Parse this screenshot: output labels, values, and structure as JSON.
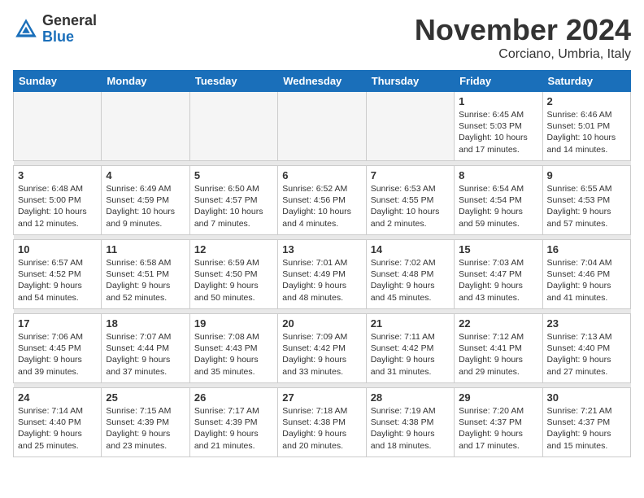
{
  "header": {
    "logo_general": "General",
    "logo_blue": "Blue",
    "month_title": "November 2024",
    "location": "Corciano, Umbria, Italy"
  },
  "weekdays": [
    "Sunday",
    "Monday",
    "Tuesday",
    "Wednesday",
    "Thursday",
    "Friday",
    "Saturday"
  ],
  "weeks": [
    {
      "days": [
        {
          "num": "",
          "info": ""
        },
        {
          "num": "",
          "info": ""
        },
        {
          "num": "",
          "info": ""
        },
        {
          "num": "",
          "info": ""
        },
        {
          "num": "",
          "info": ""
        },
        {
          "num": "1",
          "info": "Sunrise: 6:45 AM\nSunset: 5:03 PM\nDaylight: 10 hours and 17 minutes."
        },
        {
          "num": "2",
          "info": "Sunrise: 6:46 AM\nSunset: 5:01 PM\nDaylight: 10 hours and 14 minutes."
        }
      ]
    },
    {
      "days": [
        {
          "num": "3",
          "info": "Sunrise: 6:48 AM\nSunset: 5:00 PM\nDaylight: 10 hours and 12 minutes."
        },
        {
          "num": "4",
          "info": "Sunrise: 6:49 AM\nSunset: 4:59 PM\nDaylight: 10 hours and 9 minutes."
        },
        {
          "num": "5",
          "info": "Sunrise: 6:50 AM\nSunset: 4:57 PM\nDaylight: 10 hours and 7 minutes."
        },
        {
          "num": "6",
          "info": "Sunrise: 6:52 AM\nSunset: 4:56 PM\nDaylight: 10 hours and 4 minutes."
        },
        {
          "num": "7",
          "info": "Sunrise: 6:53 AM\nSunset: 4:55 PM\nDaylight: 10 hours and 2 minutes."
        },
        {
          "num": "8",
          "info": "Sunrise: 6:54 AM\nSunset: 4:54 PM\nDaylight: 9 hours and 59 minutes."
        },
        {
          "num": "9",
          "info": "Sunrise: 6:55 AM\nSunset: 4:53 PM\nDaylight: 9 hours and 57 minutes."
        }
      ]
    },
    {
      "days": [
        {
          "num": "10",
          "info": "Sunrise: 6:57 AM\nSunset: 4:52 PM\nDaylight: 9 hours and 54 minutes."
        },
        {
          "num": "11",
          "info": "Sunrise: 6:58 AM\nSunset: 4:51 PM\nDaylight: 9 hours and 52 minutes."
        },
        {
          "num": "12",
          "info": "Sunrise: 6:59 AM\nSunset: 4:50 PM\nDaylight: 9 hours and 50 minutes."
        },
        {
          "num": "13",
          "info": "Sunrise: 7:01 AM\nSunset: 4:49 PM\nDaylight: 9 hours and 48 minutes."
        },
        {
          "num": "14",
          "info": "Sunrise: 7:02 AM\nSunset: 4:48 PM\nDaylight: 9 hours and 45 minutes."
        },
        {
          "num": "15",
          "info": "Sunrise: 7:03 AM\nSunset: 4:47 PM\nDaylight: 9 hours and 43 minutes."
        },
        {
          "num": "16",
          "info": "Sunrise: 7:04 AM\nSunset: 4:46 PM\nDaylight: 9 hours and 41 minutes."
        }
      ]
    },
    {
      "days": [
        {
          "num": "17",
          "info": "Sunrise: 7:06 AM\nSunset: 4:45 PM\nDaylight: 9 hours and 39 minutes."
        },
        {
          "num": "18",
          "info": "Sunrise: 7:07 AM\nSunset: 4:44 PM\nDaylight: 9 hours and 37 minutes."
        },
        {
          "num": "19",
          "info": "Sunrise: 7:08 AM\nSunset: 4:43 PM\nDaylight: 9 hours and 35 minutes."
        },
        {
          "num": "20",
          "info": "Sunrise: 7:09 AM\nSunset: 4:42 PM\nDaylight: 9 hours and 33 minutes."
        },
        {
          "num": "21",
          "info": "Sunrise: 7:11 AM\nSunset: 4:42 PM\nDaylight: 9 hours and 31 minutes."
        },
        {
          "num": "22",
          "info": "Sunrise: 7:12 AM\nSunset: 4:41 PM\nDaylight: 9 hours and 29 minutes."
        },
        {
          "num": "23",
          "info": "Sunrise: 7:13 AM\nSunset: 4:40 PM\nDaylight: 9 hours and 27 minutes."
        }
      ]
    },
    {
      "days": [
        {
          "num": "24",
          "info": "Sunrise: 7:14 AM\nSunset: 4:40 PM\nDaylight: 9 hours and 25 minutes."
        },
        {
          "num": "25",
          "info": "Sunrise: 7:15 AM\nSunset: 4:39 PM\nDaylight: 9 hours and 23 minutes."
        },
        {
          "num": "26",
          "info": "Sunrise: 7:17 AM\nSunset: 4:39 PM\nDaylight: 9 hours and 21 minutes."
        },
        {
          "num": "27",
          "info": "Sunrise: 7:18 AM\nSunset: 4:38 PM\nDaylight: 9 hours and 20 minutes."
        },
        {
          "num": "28",
          "info": "Sunrise: 7:19 AM\nSunset: 4:38 PM\nDaylight: 9 hours and 18 minutes."
        },
        {
          "num": "29",
          "info": "Sunrise: 7:20 AM\nSunset: 4:37 PM\nDaylight: 9 hours and 17 minutes."
        },
        {
          "num": "30",
          "info": "Sunrise: 7:21 AM\nSunset: 4:37 PM\nDaylight: 9 hours and 15 minutes."
        }
      ]
    }
  ]
}
